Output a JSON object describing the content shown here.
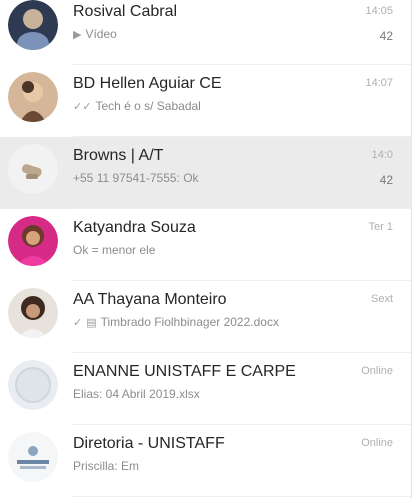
{
  "chats": [
    {
      "name": "Rosival Cabral",
      "subtitle": "Vídeo",
      "subtitle_icon": "video-icon",
      "time": "14:05",
      "count": "42",
      "avatar_colors": [
        "#3a4a66",
        "#a5b3c9"
      ]
    },
    {
      "name": "BD Hellen Aguiar CE",
      "subtitle": "Tech é o s/ Sabadal",
      "subtitle_icon": "double-check-icon",
      "time": "14:07",
      "count": "",
      "avatar_colors": [
        "#c9a98a",
        "#5b3f2d"
      ]
    },
    {
      "name": "Browns | A/T",
      "subtitle": "+55 11 97541-7555: Ok",
      "subtitle_icon": "",
      "time": "14:0",
      "count": "42",
      "avatar_colors": [
        "#e6e6e6",
        "#bfa98c"
      ],
      "selected": true
    },
    {
      "name": "Katyandra Souza",
      "subtitle": "Ok = menor ele",
      "subtitle_icon": "",
      "time": "Ter 1",
      "count": "",
      "avatar_colors": [
        "#e02a8a",
        "#3a2418"
      ]
    },
    {
      "name": "AA Thayana Monteiro",
      "subtitle": "Timbrado Fiolhbinager 2022.docx",
      "subtitle_icon": "document-icon",
      "time": "Sext",
      "count": "",
      "avatar_colors": [
        "#d8d3cc",
        "#4a3426"
      ]
    },
    {
      "name": "ENANNE UNISTAFF E CARPE",
      "subtitle": "Elias: 04 Abril 2019.xlsx",
      "subtitle_icon": "",
      "time": "Online",
      "count": "",
      "avatar_colors": [
        "#e4e8ec",
        "#c4ccd4"
      ]
    },
    {
      "name": "Diretoria - UNISTAFF",
      "subtitle": "Priscilla: Em",
      "subtitle_icon": "",
      "time": "Online",
      "count": "",
      "avatar_colors": [
        "#f1f3f5",
        "#7d97b0"
      ]
    }
  ]
}
